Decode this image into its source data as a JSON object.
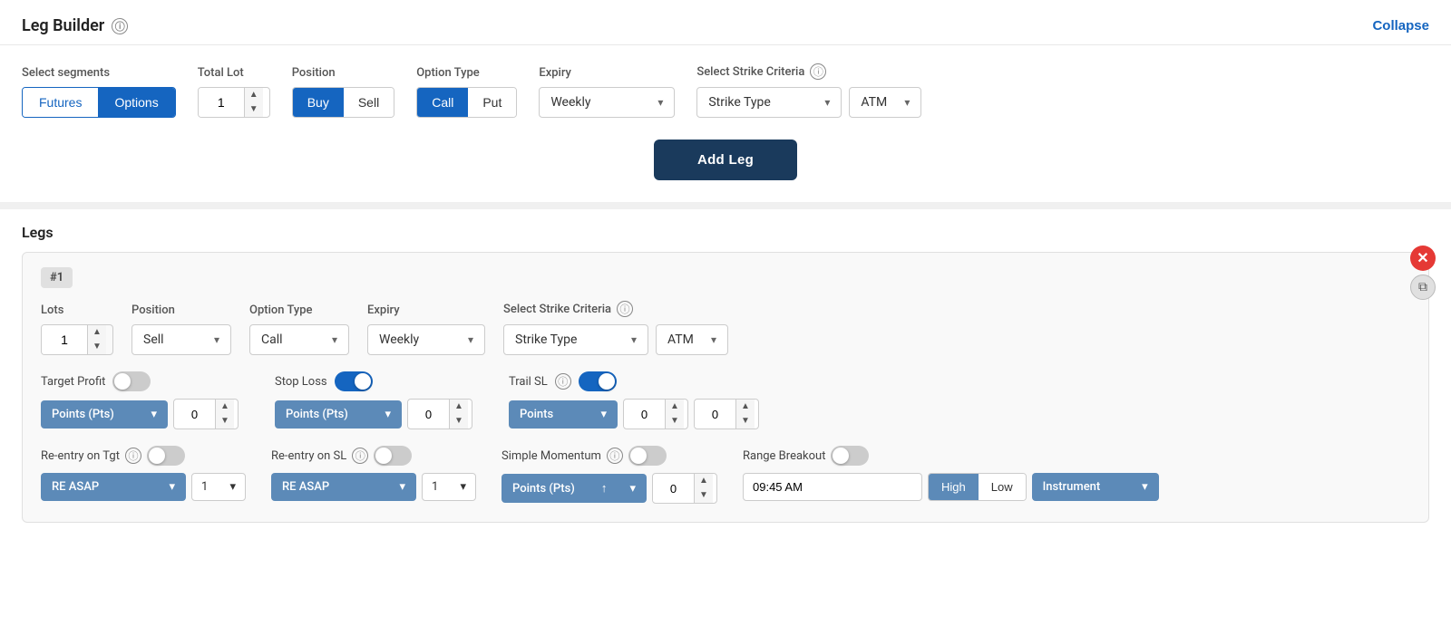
{
  "header": {
    "title": "Leg Builder",
    "collapse_label": "Collapse"
  },
  "builder": {
    "select_segments_label": "Select segments",
    "segments": [
      "Futures",
      "Options"
    ],
    "active_segment": "Options",
    "total_lot_label": "Total Lot",
    "total_lot_value": "1",
    "position_label": "Position",
    "positions": [
      "Buy",
      "Sell"
    ],
    "active_position": "Buy",
    "option_type_label": "Option Type",
    "option_types": [
      "Call",
      "Put"
    ],
    "active_option_type": "Call",
    "expiry_label": "Expiry",
    "expiry_value": "Weekly",
    "select_strike_criteria_label": "Select Strike Criteria",
    "strike_type_placeholder": "Strike Type",
    "strike_type_label": "Strike Type",
    "atm_value": "ATM",
    "add_leg_label": "Add Leg"
  },
  "legs_section": {
    "title": "Legs",
    "legs": [
      {
        "num": "#1",
        "lots_label": "Lots",
        "lots_value": "1",
        "position_label": "Position",
        "position_value": "Sell",
        "option_type_label": "Option Type",
        "option_type_value": "Call",
        "expiry_label": "Expiry",
        "expiry_value": "Weekly",
        "select_strike_criteria_label": "Select Strike Criteria",
        "strike_type_value": "Strike Type",
        "atm_value": "ATM",
        "target_profit_label": "Target Profit",
        "target_profit_on": false,
        "stop_loss_label": "Stop Loss",
        "stop_loss_on": true,
        "trail_sl_label": "Trail SL",
        "trail_sl_on": true,
        "points_label": "Points (Pts)",
        "stop_loss_pts": "0",
        "trail_sl_pts1": "0",
        "trail_sl_pts2": "0",
        "target_profit_pts": "0",
        "reentry_tgt_label": "Re-entry on Tgt",
        "reentry_tgt_on": false,
        "reentry_tgt_value": "RE ASAP",
        "reentry_tgt_count": "1",
        "reentry_sl_label": "Re-entry on SL",
        "reentry_sl_on": false,
        "reentry_sl_value": "RE ASAP",
        "reentry_sl_count": "1",
        "simple_momentum_label": "Simple Momentum",
        "simple_momentum_on": false,
        "simple_momentum_pts": "Points (Pts)",
        "simple_momentum_val": "0",
        "range_breakout_label": "Range Breakout",
        "range_breakout_on": false,
        "range_breakout_time": "09:45 AM",
        "hl_high": "High",
        "hl_low": "Low",
        "instrument_value": "Instrument"
      }
    ]
  },
  "icons": {
    "info": "ⓘ",
    "chevron_down": "▾",
    "up_arrow": "↑",
    "copy": "⧉",
    "close": "✕"
  }
}
